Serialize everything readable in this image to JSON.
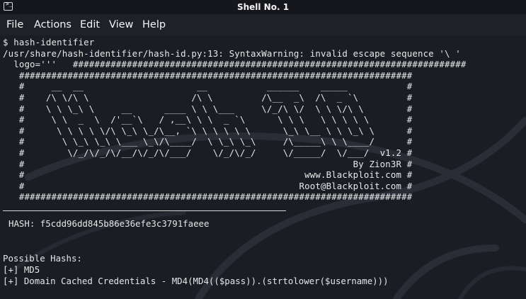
{
  "window": {
    "title": "Shell No. 1",
    "icon": "terminal-icon"
  },
  "menu": {
    "file": "File",
    "actions": "Actions",
    "edit": "Edit",
    "view": "View",
    "help": "Help"
  },
  "terminal": {
    "lines": [
      "$ hash-identifier",
      "/usr/share/hash-identifier/hash-id.py:13: SyntaxWarning: invalid escape sequence '\\ '",
      "  logo='''   #########################################################################",
      "   #########################################################################",
      "   #     __  __                     __           ______    _____           #",
      "   #    /\\ \\/\\ \\                   /\\ \\         /\\__  _\\  /\\  _ `\\         #",
      "   #    \\ \\ \\_\\ \\     __      ____ \\ \\ \\___     \\/_/\\ \\/  \\ \\ \\/\\ \\        #",
      "   #     \\ \\  _  \\  /'__`\\   / ,__\\ \\ \\  _ `\\      \\ \\ \\   \\ \\ \\ \\ \\       #",
      "   #      \\ \\ \\ \\ \\/\\ \\_\\ \\_/\\__, `\\ \\ \\ \\ \\ \\      \\_\\ \\__ \\ \\ \\_\\ \\      #",
      "   #       \\ \\_\\ \\_\\ \\___ \\_\\/\\____/  \\ \\_\\ \\_\\     /\\_____\\ \\ \\____/      #",
      "   #        \\/_/\\/_/\\/__/\\/_/\\/___/    \\/_/\\/_/     \\/_____/  \\/___/  v1.2 #",
      "   #                                                             By Zion3R #",
      "   #                                                    www.Blackploit.com #",
      "   #                                                   Root@Blackploit.com #",
      "   #########################################################################"
    ],
    "hash_line": "HASH: f5cdd96dd845b86e36efe3c3791faeee",
    "possible_label": "Possible Hashs:",
    "results": [
      "[+] MD5",
      "[+] Domain Cached Credentials - MD4(MD4(($pass)).(strtolower($username)))"
    ]
  },
  "colors": {
    "background": "#1b1d24",
    "titlebar": "#16171d",
    "menubar": "#1f2128",
    "text": "#e8e8e8"
  }
}
